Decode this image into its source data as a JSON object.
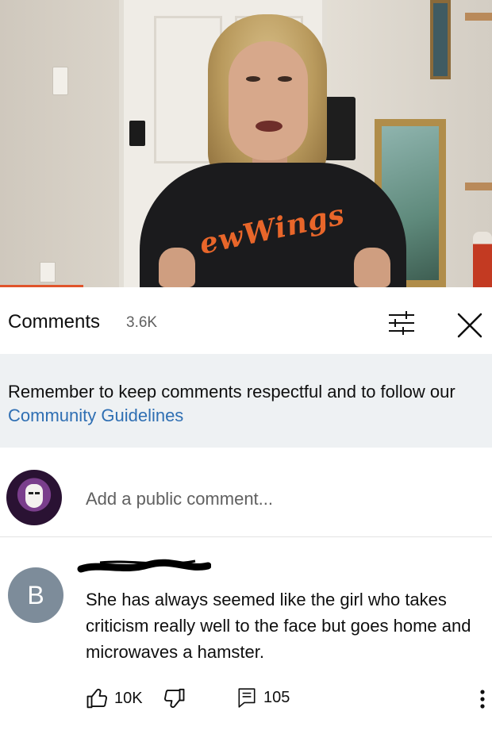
{
  "video": {
    "shirt_text": "ewWings",
    "progress_fraction": 0.17
  },
  "comments_panel": {
    "title": "Comments",
    "count": "3.6K",
    "sort_icon": "sort-sliders-icon",
    "close_icon": "close-icon"
  },
  "banner": {
    "text_before": "Remember to keep comments respectful and to follow our ",
    "link_text": "Community Guidelines"
  },
  "add_comment": {
    "placeholder": "Add a public comment..."
  },
  "comment": {
    "avatar_letter": "B",
    "text": "She has always seemed like the girl who takes criticism really well to the face but goes home and microwaves a hamster.",
    "like_count": "10K",
    "reply_count": "105"
  },
  "colors": {
    "link": "#2f6fb3",
    "banner_bg": "#eef1f3",
    "avatar_b": "#7d8c9a",
    "progress": "#e0542b"
  }
}
